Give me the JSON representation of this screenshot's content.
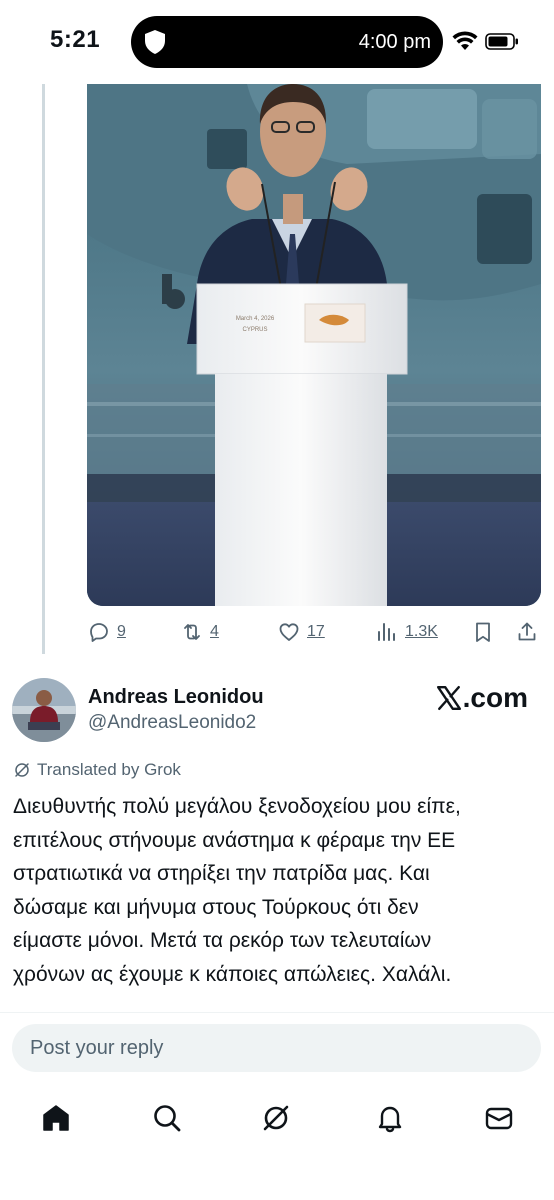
{
  "status_bar": {
    "time": "5:21",
    "island_time": "4:00 pm"
  },
  "tweet": {
    "image": {
      "podium_text_line1": "March 4, 2026",
      "podium_text_line2": "CYPRUS"
    },
    "actions": {
      "replies": "9",
      "retweets": "4",
      "likes": "17",
      "views": "1.3K"
    }
  },
  "author": {
    "name": "Andreas Leonidou",
    "handle": "@AndreasLeonido2",
    "badge": ".com"
  },
  "translation_note": "Translated by Grok",
  "post_text": "Διευθυντής πολύ μεγάλου ξενοδοχείου μου είπε,\nεπιτέλους στήνουμε ανάστημα κ φέραμε την ΕΕ\nστρατιωτικά να στηρίξει την πατρίδα μας. Και\nδώσαμε και μήνυμα στους Τούρκους ότι δεν\nείμαστε μόνοι. Μετά τα ρεκόρ των τελευταίων\nχρόνων ας έχουμε κ κάποιες απώλειες. Χαλάλι.",
  "reply": {
    "placeholder": "Post your reply"
  },
  "icons": {
    "reply": "reply-icon",
    "retweet": "retweet-icon",
    "like": "heart-icon",
    "views": "views-icon",
    "bookmark": "bookmark-icon",
    "share": "share-icon",
    "home": "home-icon",
    "search": "search-icon",
    "grok": "grok-icon",
    "notifications": "bell-icon",
    "messages": "mail-icon"
  },
  "colors": {
    "text_primary": "#0f1419",
    "text_secondary": "#536471",
    "thread_line": "#cfd9de",
    "reply_bg": "#eff3f4"
  }
}
